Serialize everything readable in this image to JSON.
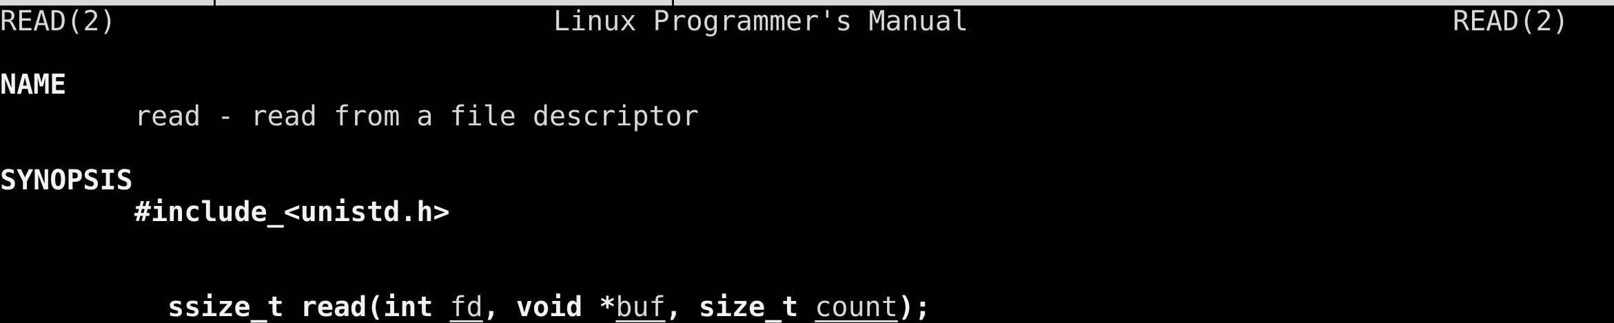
{
  "header": {
    "left": "READ(2)",
    "center": "Linux Programmer's Manual",
    "right": "READ(2)"
  },
  "sections": {
    "name": {
      "heading": "NAME",
      "text": "read - read from a file descriptor"
    },
    "synopsis": {
      "heading": "SYNOPSIS",
      "include": "#include_<unistd.h>",
      "prototype": {
        "pre": "ssize_t read(int ",
        "arg1": "fd",
        "mid1": ", void *",
        "arg2": "buf",
        "mid2": ", size_t ",
        "arg3": "count",
        "post": ");"
      }
    }
  }
}
